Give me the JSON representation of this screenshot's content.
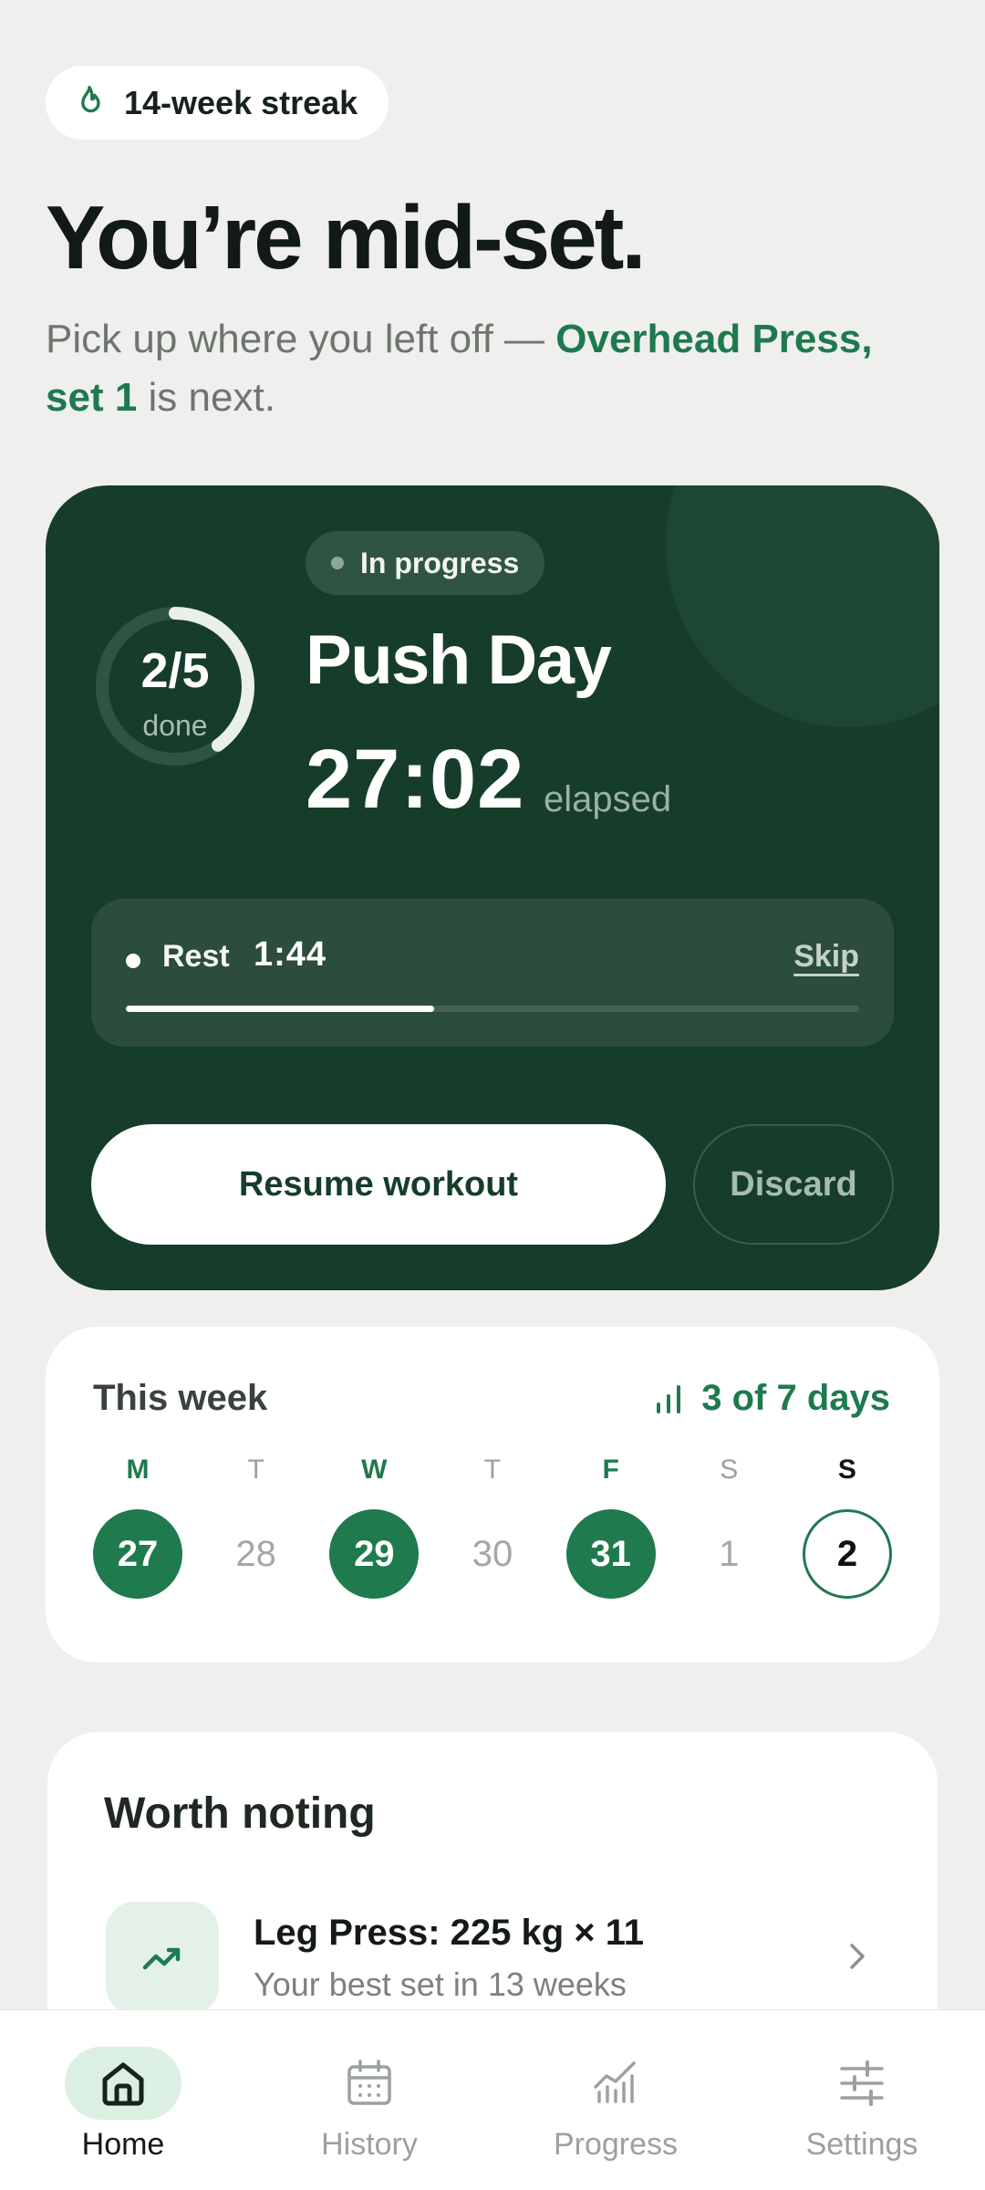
{
  "streak": {
    "icon": "flame-icon",
    "label": "14-week streak"
  },
  "headline": "You’re mid-set.",
  "subline": {
    "lead": "Pick up where you left off — ",
    "highlight": "Overhead Press, set 1",
    "tail": " is next."
  },
  "active_workout": {
    "status": "In progress",
    "name": "Push Day",
    "sets_done": "2/5",
    "sets_label": "done",
    "sets_progress": 0.4,
    "elapsed": "27:02",
    "elapsed_label": "elapsed",
    "rest": {
      "label": "Rest",
      "time": "1:44",
      "skip": "Skip",
      "progress": 0.42
    },
    "resume_label": "Resume workout",
    "discard_label": "Discard"
  },
  "week": {
    "title": "This week",
    "summary": "3 of 7 days",
    "days": [
      {
        "letter": "M",
        "date": "27",
        "state": "done"
      },
      {
        "letter": "T",
        "date": "28",
        "state": "rest"
      },
      {
        "letter": "W",
        "date": "29",
        "state": "done"
      },
      {
        "letter": "T",
        "date": "30",
        "state": "rest"
      },
      {
        "letter": "F",
        "date": "31",
        "state": "done"
      },
      {
        "letter": "S",
        "date": "1",
        "state": "rest"
      },
      {
        "letter": "S",
        "date": "2",
        "state": "today"
      }
    ]
  },
  "notes": {
    "title": "Worth noting",
    "items": [
      {
        "icon": "trending-up-icon",
        "title": "Leg Press: 225 kg × 11",
        "subtitle": "Your best set in 13 weeks"
      }
    ]
  },
  "nav": {
    "items": [
      {
        "label": "Home",
        "icon": "home-icon",
        "active": true
      },
      {
        "label": "History",
        "icon": "calendar-icon",
        "active": false
      },
      {
        "label": "Progress",
        "icon": "chart-icon",
        "active": false
      },
      {
        "label": "Settings",
        "icon": "sliders-icon",
        "active": false
      }
    ]
  },
  "colors": {
    "accent": "#1f7a4e",
    "card_dark": "#163d2a",
    "background": "#efefee"
  }
}
